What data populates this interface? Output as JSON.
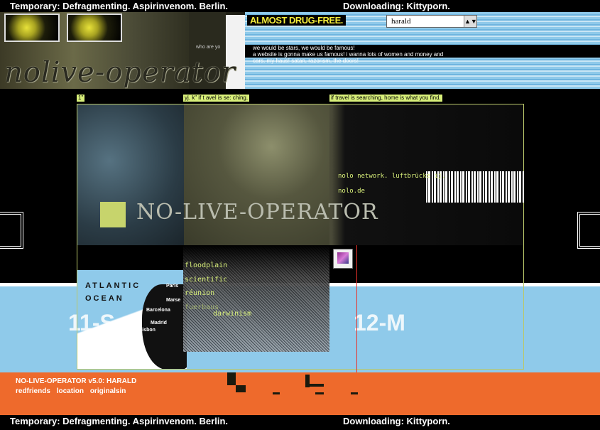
{
  "ticker": {
    "left": "Temporary: Defragmenting. Aspirinvenom. Berlin.",
    "right": "Downloading: Kittyporn."
  },
  "header": {
    "logo_text": "nolive-operator",
    "who_text": "who are yo",
    "tagline": "ALMOST DRUG-FREE.",
    "intro_lines": [
      "we would be stars, we would be famous!",
      "a website is gonna make us famous! i wanna lots of women and money and",
      "cars. my haus! satan, razorism, the doors!"
    ],
    "user_select": "harald"
  },
  "tags": {
    "a": "1\"",
    "b": "yj. k\" if t avel is se: ching.",
    "c": "if travel is searching, home is what you find."
  },
  "main": {
    "title": "NO-LIVE-OPERATOR",
    "network_link": "nolo network. luftbrücke ij.",
    "nolo_link": "nolo.de",
    "menu": [
      "floodplain",
      "scientific",
      "réunion",
      "fuerbaus",
      "darwinism"
    ]
  },
  "map": {
    "ocean_line1": "ATLANTIC",
    "ocean_line2": "OCEAN",
    "cities": [
      "Paris",
      "Marse",
      "Barcelona",
      "Madrid",
      "Lisbon"
    ],
    "date_left": "11-S",
    "date_right": "12-M"
  },
  "footer": {
    "title": "NO-LIVE-OPERATOR v5.0: HARALD",
    "nav": [
      "redfriends",
      "location",
      "originalsin"
    ]
  },
  "colors": {
    "accent_yellow": "#f5ec3a",
    "lime": "#d8ef7a",
    "sky": "#8fcaea",
    "orange": "#ee6a2c"
  }
}
